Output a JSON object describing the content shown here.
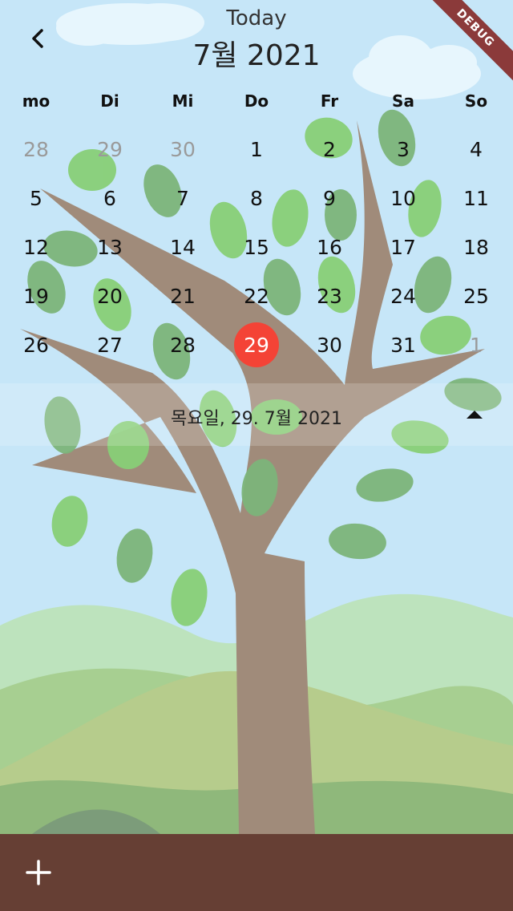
{
  "header": {
    "today_label": "Today",
    "month_title": "7월 2021",
    "back_icon": "chevron-left-icon"
  },
  "weekdays": [
    "mo",
    "Di",
    "Mi",
    "Do",
    "Fr",
    "Sa",
    "So"
  ],
  "calendar": {
    "weeks": [
      [
        {
          "d": "28",
          "other": true
        },
        {
          "d": "29",
          "other": true
        },
        {
          "d": "30",
          "other": true
        },
        {
          "d": "1"
        },
        {
          "d": "2"
        },
        {
          "d": "3"
        },
        {
          "d": "4"
        }
      ],
      [
        {
          "d": "5"
        },
        {
          "d": "6"
        },
        {
          "d": "7"
        },
        {
          "d": "8"
        },
        {
          "d": "9"
        },
        {
          "d": "10"
        },
        {
          "d": "11"
        }
      ],
      [
        {
          "d": "12"
        },
        {
          "d": "13"
        },
        {
          "d": "14"
        },
        {
          "d": "15"
        },
        {
          "d": "16"
        },
        {
          "d": "17"
        },
        {
          "d": "18"
        }
      ],
      [
        {
          "d": "19"
        },
        {
          "d": "20"
        },
        {
          "d": "21"
        },
        {
          "d": "22"
        },
        {
          "d": "23"
        },
        {
          "d": "24"
        },
        {
          "d": "25"
        }
      ],
      [
        {
          "d": "26"
        },
        {
          "d": "27"
        },
        {
          "d": "28"
        },
        {
          "d": "29",
          "selected": true
        },
        {
          "d": "30"
        },
        {
          "d": "31"
        },
        {
          "d": "1",
          "other": true
        }
      ]
    ],
    "selected_color": "#f44336"
  },
  "selected_date": {
    "text": "목요일, 29. 7월 2021",
    "collapse_icon": "triangle-up-icon"
  },
  "bottom_bar": {
    "add_icon": "plus-icon",
    "color": "#663f34"
  },
  "debug_banner": "DEBUG",
  "colors": {
    "sky": "#c6e6f8",
    "trunk": "#a08b7a",
    "leaf_light": "#88cf77",
    "leaf_dark": "#7db57a",
    "hill_light": "#bde3bd",
    "hill_mid": "#a7cf91"
  }
}
